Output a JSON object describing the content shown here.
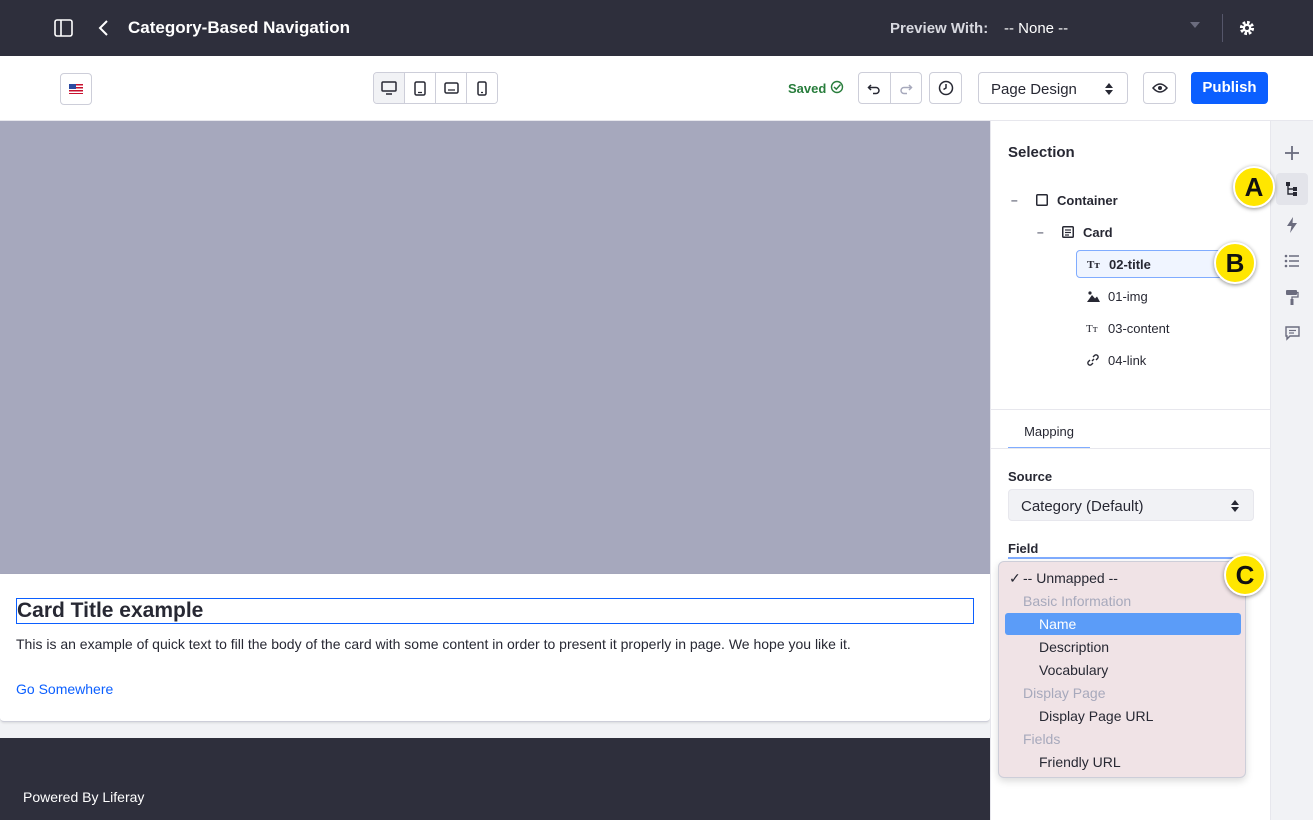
{
  "header": {
    "title": "Category-Based Navigation",
    "preview_label": "Preview With:",
    "preview_value": "-- None --"
  },
  "toolbar": {
    "saved_label": "Saved",
    "mode_value": "Page Design",
    "publish_label": "Publish",
    "devices": [
      "desktop-icon",
      "tablet-icon",
      "landscape-icon",
      "phone-icon"
    ]
  },
  "canvas": {
    "card_title": "Card Title example",
    "card_text": "This is an example of quick text to fill the body of the card with some content in order to present it properly in page. We hope you like it.",
    "card_link": "Go Somewhere",
    "footer_text": "Powered By Liferay"
  },
  "panel": {
    "selection_title": "Selection",
    "tree": [
      {
        "label": "Container",
        "icon": "container-icon"
      },
      {
        "label": "Card",
        "icon": "fragment-icon"
      },
      {
        "label": "02-title",
        "icon": "text-icon"
      },
      {
        "label": "01-img",
        "icon": "image-icon"
      },
      {
        "label": "03-content",
        "icon": "text-icon"
      },
      {
        "label": "04-link",
        "icon": "link-icon"
      }
    ],
    "tab_mapping": "Mapping",
    "source_label": "Source",
    "source_value": "Category (Default)",
    "field_label": "Field"
  },
  "dropdown": {
    "checked": "-- Unmapped --",
    "groups": [
      {
        "header": "Basic Information",
        "options": [
          "Name",
          "Description",
          "Vocabulary"
        ]
      },
      {
        "header": "Display Page",
        "options": [
          "Display Page URL"
        ]
      },
      {
        "header": "Fields",
        "options": [
          "Friendly URL"
        ]
      }
    ],
    "active_option": "Name"
  },
  "callouts": [
    "A",
    "B",
    "C"
  ],
  "colors": {
    "topbar": "#2e2f3c",
    "accent": "#0b5fff",
    "saved": "#287d3c",
    "callout": "#ffe600",
    "dropdown_active": "#5b9cf8"
  }
}
